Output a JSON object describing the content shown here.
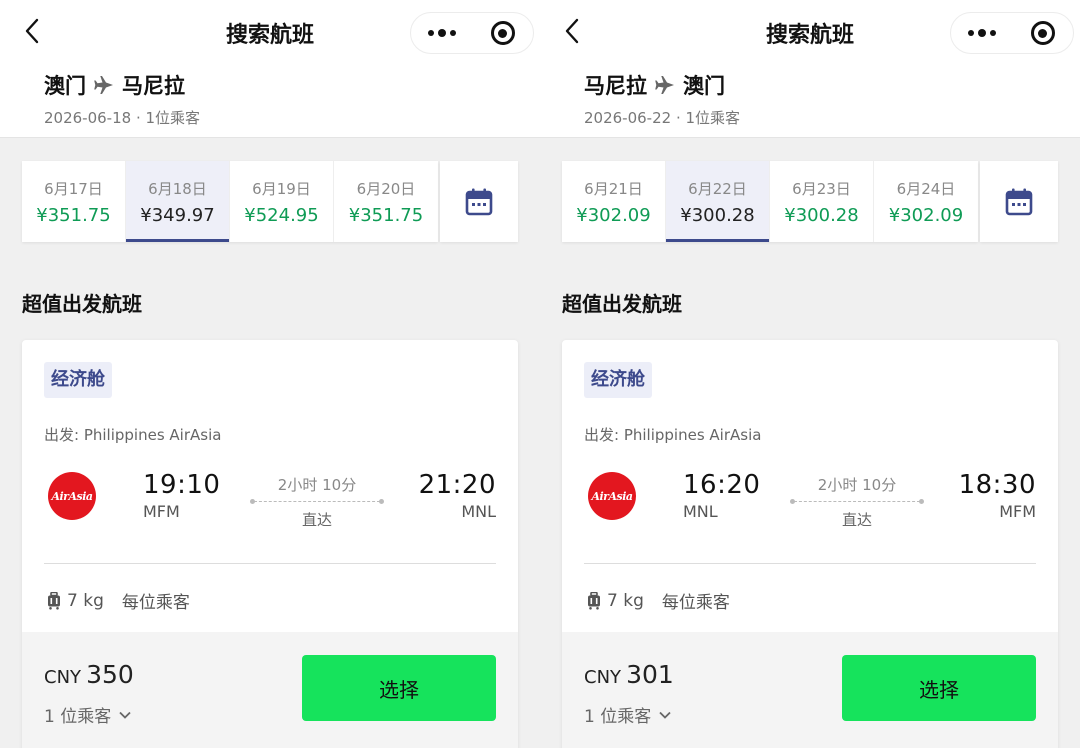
{
  "screens": [
    {
      "nav_title": "搜索航班",
      "origin": "澳门",
      "destination": "马尼拉",
      "subtitle": "2026-06-18 · 1位乘客",
      "dates": [
        {
          "date": "6月17日",
          "price": "¥351.75",
          "selected": false
        },
        {
          "date": "6月18日",
          "price": "¥349.97",
          "selected": true
        },
        {
          "date": "6月19日",
          "price": "¥524.95",
          "selected": false
        },
        {
          "date": "6月20日",
          "price": "¥351.75",
          "selected": false
        }
      ],
      "section_title": "超值出发航班",
      "flight": {
        "cabin": "经济舱",
        "carrier": "出发: Philippines AirAsia",
        "logo_text": "AirAsia",
        "dep_time": "19:10",
        "dep_code": "MFM",
        "duration": "2小时 10分",
        "stops": "直达",
        "arr_time": "21:20",
        "arr_code": "MNL",
        "baggage": "7 kg",
        "baggage_note": "每位乘客",
        "currency": "CNY",
        "price": "350",
        "passengers": "1 位乘客",
        "select_label": "选择"
      }
    },
    {
      "nav_title": "搜索航班",
      "origin": "马尼拉",
      "destination": "澳门",
      "subtitle": "2026-06-22 · 1位乘客",
      "dates": [
        {
          "date": "6月21日",
          "price": "¥302.09",
          "selected": false
        },
        {
          "date": "6月22日",
          "price": "¥300.28",
          "selected": true
        },
        {
          "date": "6月23日",
          "price": "¥300.28",
          "selected": false
        },
        {
          "date": "6月24日",
          "price": "¥302.09",
          "selected": false
        }
      ],
      "section_title": "超值出发航班",
      "flight": {
        "cabin": "经济舱",
        "carrier": "出发: Philippines AirAsia",
        "logo_text": "AirAsia",
        "dep_time": "16:20",
        "dep_code": "MNL",
        "duration": "2小时 10分",
        "stops": "直达",
        "arr_time": "18:30",
        "arr_code": "MFM",
        "baggage": "7 kg",
        "baggage_note": "每位乘客",
        "currency": "CNY",
        "price": "301",
        "passengers": "1 位乘客",
        "select_label": "选择"
      }
    }
  ],
  "icons": {
    "back": "chevron-left-icon",
    "more": "more-dots-icon",
    "close": "target-circle-icon",
    "plane": "airplane-icon",
    "calendar": "calendar-icon",
    "baggage": "luggage-icon",
    "dropdown": "chevron-down-icon"
  },
  "colors": {
    "price_green": "#0f9b55",
    "accent_navy": "#3d4a8c",
    "select_button": "#16e35c",
    "airasia_red": "#e3171f"
  }
}
